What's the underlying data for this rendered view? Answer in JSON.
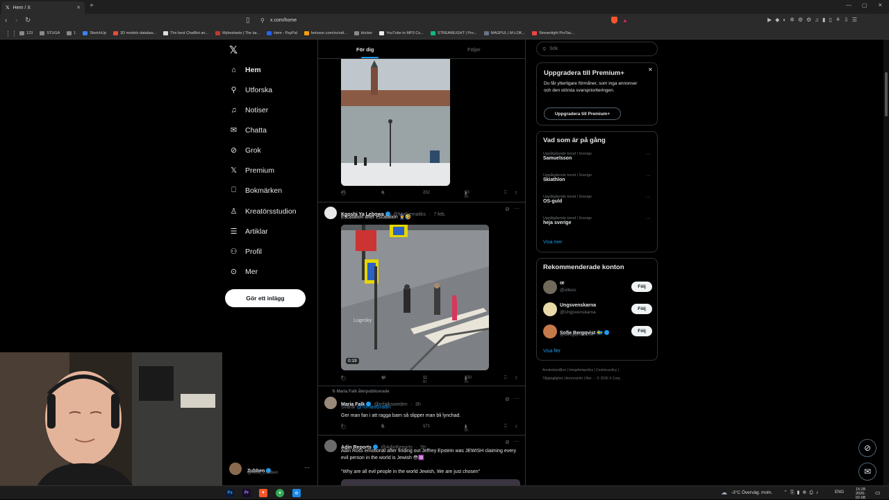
{
  "browser": {
    "tab_title": "Hem / X",
    "url": "x.com/home",
    "bookmarks": [
      "123",
      "STUGA",
      "1",
      "SketchUp",
      "3D models databas...",
      "The best ChatBot an...",
      "Mybestants | The lar...",
      "Hem - PayPal",
      "betsson.com/sv/odi...",
      "böcker",
      "YouTube to MP3 Co...",
      "STREAMLIGHT | Pro...",
      "MAGPUL | M-LOK...",
      "Streamlight ProTac..."
    ]
  },
  "sidebar": {
    "items": [
      {
        "label": "Hem",
        "icon": "home-icon"
      },
      {
        "label": "Utforska",
        "icon": "search-icon"
      },
      {
        "label": "Notiser",
        "icon": "bell-icon"
      },
      {
        "label": "Chatta",
        "icon": "mail-icon"
      },
      {
        "label": "Grok",
        "icon": "grok-icon"
      },
      {
        "label": "Premium",
        "icon": "x-logo-icon"
      },
      {
        "label": "Bokmärken",
        "icon": "bookmark-icon"
      },
      {
        "label": "Kreatörsstudion",
        "icon": "creator-icon"
      },
      {
        "label": "Artiklar",
        "icon": "article-icon"
      },
      {
        "label": "Profil",
        "icon": "person-icon"
      },
      {
        "label": "Mer",
        "icon": "more-icon"
      }
    ],
    "post_button": "Gör ett inlägg",
    "account": {
      "name": "Zubben",
      "handle": "@Kick_Zubben"
    }
  },
  "feed": {
    "tabs": [
      "För dig",
      "Följer"
    ],
    "tweet1": {
      "replies": "45",
      "reposts": "4",
      "likes": "232",
      "views": "53 tn"
    },
    "tweet2": {
      "name": "Kgoshi Ya Lebowa",
      "handle": "@Mothematiks",
      "date": "7 feb.",
      "text": "Escalation after escalation 👮‍♂️🤣",
      "video_duration": "0:19",
      "watermark": "Lugnsky",
      "replies": "9",
      "reposts": "44",
      "likes": "11 tn",
      "views": "230 tn"
    },
    "tweet3": {
      "repost_label": "Maria Falk återpublicerade",
      "name": "Maria Falk",
      "handle": "@mfalksweden",
      "date": "3h",
      "reply_prefix": "Svarar",
      "reply_to": "@TomasGradin",
      "text": "Ger man fan i att ragga barn så slipper man bli lynchad.",
      "replies": "5",
      "reposts": "8",
      "likes": "171",
      "views": "1 tn"
    },
    "tweet4": {
      "name": "Adin Reports",
      "handle": "@AdinReports",
      "date": "5h",
      "text": "Adin Ross emotional after finding out Jeffrey Epstein was JEWISH claiming every evil person in the world is Jewish 😳🔯",
      "quote": "\"Why are all evil people in the world Jewish, We are just chosen\""
    }
  },
  "right": {
    "search_placeholder": "Sök",
    "premium": {
      "title": "Uppgradera till Premium+",
      "text": "Du får ytterligare förmåner, som inga annonser och den största svarsprioriteringen.",
      "button": "Uppgradera till Premium+"
    },
    "trends": {
      "title": "Vad som är på gång",
      "items": [
        {
          "sub": "Uppåtgående trend i Sverige",
          "title": "Samuelsson"
        },
        {
          "sub": "Uppåtgående trend i Sverige",
          "title": "Skiathlon"
        },
        {
          "sub": "Uppåtgående trend i Sverige",
          "title": "OS-guld"
        },
        {
          "sub": "Uppåtgående trend i Sverige",
          "title": "heja sverige"
        }
      ],
      "more": "Visa mer"
    },
    "recommended": {
      "title": "Rekommenderade konton",
      "accounts": [
        {
          "name": "œ",
          "handle": "@olleos"
        },
        {
          "name": "Ungsvenskarna",
          "handle": "@Ungsvenskarna"
        },
        {
          "name": "Sofie Bergqvist 🇸🇪",
          "handle": "@BergqvistSofie"
        }
      ],
      "follow": "Följ",
      "more": "Visa fler"
    },
    "footer": {
      "line1": "Användarvillkor  |  Integritetspolicy  |  Cookie-policy  |",
      "line2": "Tillgänglighet  |  Annonsinfo  |  Mer ···  © 2026 X Corp."
    }
  },
  "taskbar": {
    "weather": "-3°C  Överväg. moln.",
    "lang": "ENG",
    "time": "15:28",
    "date": "2026-02-08"
  }
}
